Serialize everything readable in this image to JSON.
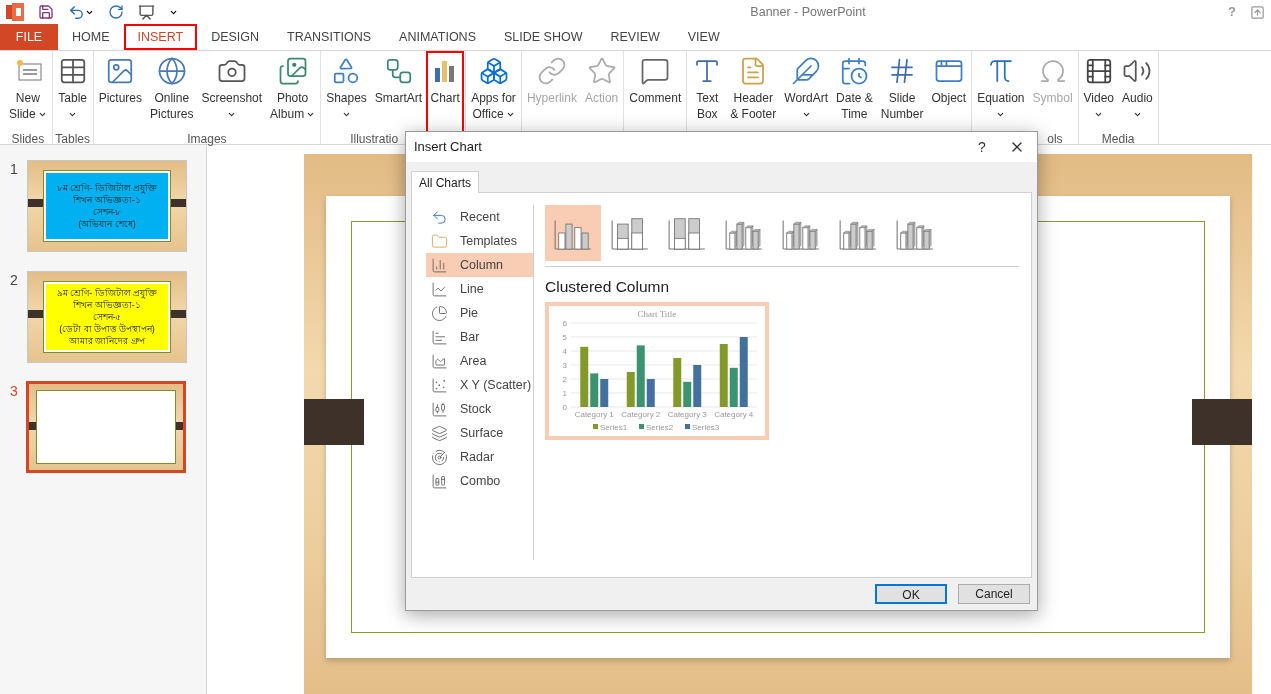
{
  "window": {
    "title": "Banner - PowerPoint",
    "help": "?"
  },
  "file_tab": "FILE",
  "tabs": [
    {
      "label": "HOME",
      "selected": false,
      "outlined": false
    },
    {
      "label": "INSERT",
      "selected": true,
      "outlined": true
    },
    {
      "label": "DESIGN",
      "selected": false,
      "outlined": false
    },
    {
      "label": "TRANSITIONS",
      "selected": false,
      "outlined": false
    },
    {
      "label": "ANIMATIONS",
      "selected": false,
      "outlined": false
    },
    {
      "label": "SLIDE SHOW",
      "selected": false,
      "outlined": false
    },
    {
      "label": "REVIEW",
      "selected": false,
      "outlined": false
    },
    {
      "label": "VIEW",
      "selected": false,
      "outlined": false
    }
  ],
  "ribbon_groups": [
    {
      "label": "Slides",
      "items": [
        {
          "lines": [
            "New",
            "Slide"
          ],
          "dropdown": true,
          "disabled": false,
          "outlined": false
        }
      ]
    },
    {
      "label": "Tables",
      "items": [
        {
          "lines": [
            "Table"
          ],
          "dropdown": true,
          "disabled": false,
          "outlined": false
        }
      ]
    },
    {
      "label": "Images",
      "items": [
        {
          "lines": [
            "Pictures"
          ],
          "dropdown": false,
          "disabled": false,
          "outlined": false
        },
        {
          "lines": [
            "Online",
            "Pictures"
          ],
          "dropdown": false,
          "disabled": false,
          "outlined": false
        },
        {
          "lines": [
            "Screenshot"
          ],
          "dropdown": true,
          "disabled": false,
          "outlined": false
        },
        {
          "lines": [
            "Photo",
            "Album"
          ],
          "dropdown": true,
          "disabled": false,
          "outlined": false
        }
      ]
    },
    {
      "label": "Illustratio",
      "items": [
        {
          "lines": [
            "Shapes"
          ],
          "dropdown": true,
          "disabled": false,
          "outlined": false
        },
        {
          "lines": [
            "SmartArt"
          ],
          "dropdown": false,
          "disabled": false,
          "outlined": false
        },
        {
          "lines": [
            "Chart"
          ],
          "dropdown": false,
          "disabled": false,
          "outlined": true
        }
      ]
    },
    {
      "items": [
        {
          "lines": [
            "Apps for",
            "Office"
          ],
          "dropdown": true,
          "disabled": false,
          "outlined": false
        }
      ]
    },
    {
      "items": [
        {
          "lines": [
            "Hyperlink"
          ],
          "dropdown": false,
          "disabled": true,
          "outlined": false
        },
        {
          "lines": [
            "Action"
          ],
          "dropdown": false,
          "disabled": true,
          "outlined": false
        }
      ]
    },
    {
      "items": [
        {
          "lines": [
            "Comment"
          ],
          "dropdown": false,
          "disabled": false,
          "outlined": false
        }
      ]
    },
    {
      "items": [
        {
          "lines": [
            "Text",
            "Box"
          ],
          "dropdown": false,
          "disabled": false,
          "outlined": false
        },
        {
          "lines": [
            "Header",
            "& Footer"
          ],
          "dropdown": false,
          "disabled": false,
          "outlined": false
        },
        {
          "lines": [
            "WordArt"
          ],
          "dropdown": true,
          "disabled": false,
          "outlined": false
        },
        {
          "lines": [
            "Date &",
            "Time"
          ],
          "dropdown": false,
          "disabled": false,
          "outlined": false
        },
        {
          "lines": [
            "Slide",
            "Number"
          ],
          "dropdown": false,
          "disabled": false,
          "outlined": false
        },
        {
          "lines": [
            "Object"
          ],
          "dropdown": false,
          "disabled": false,
          "outlined": false
        }
      ]
    },
    {
      "label": "ols",
      "items": [
        {
          "lines": [
            "Equation"
          ],
          "dropdown": true,
          "disabled": false,
          "outlined": false
        },
        {
          "lines": [
            "Symbol"
          ],
          "dropdown": false,
          "disabled": true,
          "outlined": false
        }
      ]
    },
    {
      "label": "Media",
      "items": [
        {
          "lines": [
            "Video"
          ],
          "dropdown": true,
          "disabled": false,
          "outlined": false
        },
        {
          "lines": [
            "Audio"
          ],
          "dropdown": true,
          "disabled": false,
          "outlined": false
        }
      ]
    }
  ],
  "slides": [
    {
      "number": "1",
      "selected": false,
      "color": "#00b0f0",
      "lines": [
        "৮ম শ্রেণি- ডিজিটাল প্রযুক্তি",
        "শিখন অভিজ্ঞতা-১",
        "সেশন-৮",
        "(অভিযান শেষে)"
      ]
    },
    {
      "number": "2",
      "selected": false,
      "color": "#ffff00",
      "lines": [
        "৯ম শ্রেণি- ডিজিটাল প্রযুক্তি",
        "শিখন অভিজ্ঞতা-১",
        "সেশন-৫",
        "(ডেটা বা উপাত্ত উপস্থাপন)",
        "আমার জানিদের গ্রুপ"
      ]
    },
    {
      "number": "3",
      "selected": true
    }
  ],
  "dialog": {
    "title": "Insert Chart",
    "help": "?",
    "tabs": [
      {
        "label": "All Charts",
        "selected": true
      }
    ],
    "chart_types": [
      {
        "label": "Recent",
        "selected": false
      },
      {
        "label": "Templates",
        "selected": false
      },
      {
        "label": "Column",
        "selected": true
      },
      {
        "label": "Line",
        "selected": false
      },
      {
        "label": "Pie",
        "selected": false
      },
      {
        "label": "Bar",
        "selected": false
      },
      {
        "label": "Area",
        "selected": false
      },
      {
        "label": "X Y (Scatter)",
        "selected": false
      },
      {
        "label": "Stock",
        "selected": false
      },
      {
        "label": "Surface",
        "selected": false
      },
      {
        "label": "Radar",
        "selected": false
      },
      {
        "label": "Combo",
        "selected": false
      }
    ],
    "subtypes": [
      {
        "selected": true
      },
      {
        "selected": false
      },
      {
        "selected": false
      },
      {
        "selected": false
      },
      {
        "selected": false
      },
      {
        "selected": false
      },
      {
        "selected": false
      }
    ],
    "subtype_title": "Clustered Column",
    "preview": {
      "chart_data": {
        "type": "bar",
        "title": "Chart Title",
        "categories": [
          "Category 1",
          "Category 2",
          "Category 3",
          "Category 4"
        ],
        "series": [
          {
            "name": "Series1",
            "color": "#84992b",
            "values": [
              4.3,
              2.5,
              3.5,
              4.5
            ]
          },
          {
            "name": "Series2",
            "color": "#3b9370",
            "values": [
              2.4,
              4.4,
              1.8,
              2.8
            ]
          },
          {
            "name": "Series3",
            "color": "#43709d",
            "values": [
              2,
              2,
              3,
              5
            ]
          }
        ],
        "ylim": [
          0,
          6
        ],
        "yticks": [
          {
            "value": 0,
            "label": "0"
          },
          {
            "value": 1,
            "label": "1"
          },
          {
            "value": 2,
            "label": "2"
          },
          {
            "value": 3,
            "label": "3"
          },
          {
            "value": 4,
            "label": "4"
          },
          {
            "value": 5,
            "label": "5"
          },
          {
            "value": 6,
            "label": "6"
          }
        ],
        "grid": true,
        "legend": "bottom"
      }
    },
    "buttons": [
      {
        "label": "OK",
        "default": true
      },
      {
        "label": "Cancel",
        "default": false
      }
    ]
  }
}
